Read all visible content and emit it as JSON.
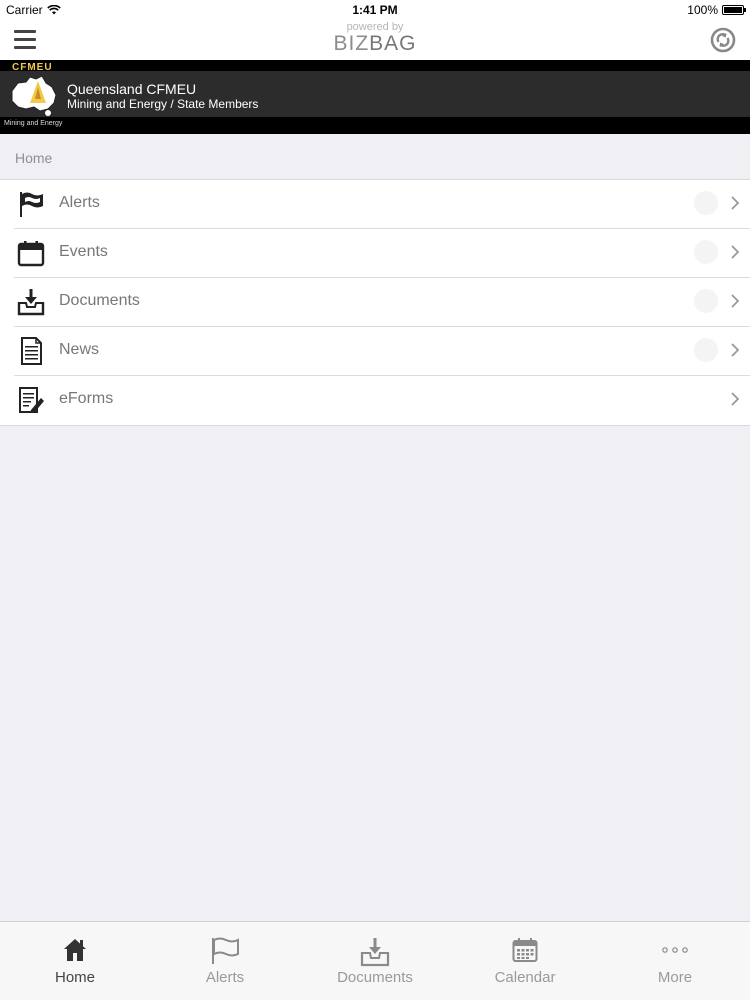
{
  "status_bar": {
    "carrier": "Carrier",
    "time": "1:41 PM",
    "battery": "100%"
  },
  "header": {
    "powered_by": "powered by",
    "brand_left": "BIZ",
    "brand_right": "BAG"
  },
  "banner": {
    "tag": "CFMEU",
    "subtitle": "Mining and Energy",
    "org_name": "Queensland CFMEU",
    "org_desc": "Mining and Energy / State Members"
  },
  "section": {
    "title": "Home"
  },
  "menu": {
    "items": [
      {
        "label": "Alerts",
        "icon": "flag-icon"
      },
      {
        "label": "Events",
        "icon": "calendar-icon"
      },
      {
        "label": "Documents",
        "icon": "inbox-download-icon"
      },
      {
        "label": "News",
        "icon": "document-icon"
      },
      {
        "label": "eForms",
        "icon": "form-edit-icon"
      }
    ]
  },
  "tabs": {
    "items": [
      {
        "label": "Home",
        "icon": "home-icon",
        "active": true
      },
      {
        "label": "Alerts",
        "icon": "flag-icon"
      },
      {
        "label": "Documents",
        "icon": "inbox-download-icon"
      },
      {
        "label": "Calendar",
        "icon": "calendar-icon"
      },
      {
        "label": "More",
        "icon": "more-dots-icon"
      }
    ]
  },
  "colors": {
    "accent_gold": "#f2c94c",
    "banner_bg": "#2c2c2c",
    "page_bg": "#efeff4"
  }
}
